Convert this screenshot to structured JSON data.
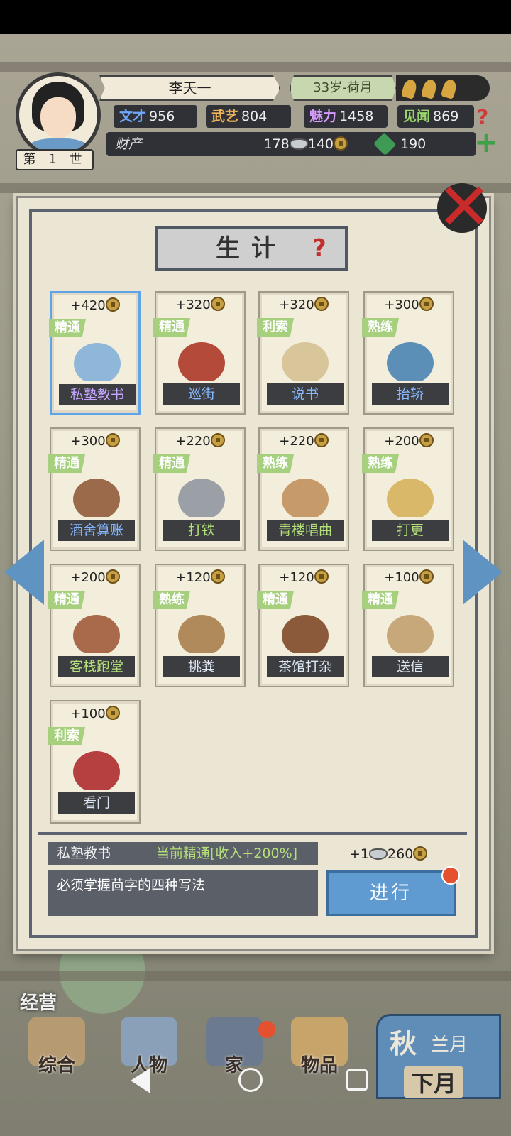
{
  "hud": {
    "name": "李天一",
    "age": "33岁-荷月",
    "generation": "第 1 世",
    "stats": [
      {
        "key": "文才",
        "value": "956"
      },
      {
        "key": "武艺",
        "value": "804"
      },
      {
        "key": "魅力",
        "value": "1458"
      },
      {
        "key": "见闻",
        "value": "869"
      }
    ],
    "wealth_label": "财产",
    "silver": "178",
    "coins": "140",
    "jade": "190",
    "help_icon": "question-icon",
    "plus_icon": "plus-icon"
  },
  "modal": {
    "title": "生计",
    "jobs": [
      {
        "income": "+420",
        "rank": "精通",
        "name": "私塾教书",
        "name_color": "purple",
        "selected": true
      },
      {
        "income": "+320",
        "rank": "精通",
        "name": "巡街",
        "name_color": "blue"
      },
      {
        "income": "+320",
        "rank": "利索",
        "name": "说书",
        "name_color": "blue"
      },
      {
        "income": "+300",
        "rank": "熟练",
        "name": "抬轿",
        "name_color": "blue"
      },
      {
        "income": "+300",
        "rank": "精通",
        "name": "酒舍算账",
        "name_color": "blue"
      },
      {
        "income": "+220",
        "rank": "精通",
        "name": "打铁",
        "name_color": "green"
      },
      {
        "income": "+220",
        "rank": "熟练",
        "name": "青楼唱曲",
        "name_color": "green"
      },
      {
        "income": "+200",
        "rank": "熟练",
        "name": "打更",
        "name_color": "green"
      },
      {
        "income": "+200",
        "rank": "精通",
        "name": "客栈跑堂",
        "name_color": "green"
      },
      {
        "income": "+120",
        "rank": "熟练",
        "name": "挑粪",
        "name_color": "plain"
      },
      {
        "income": "+120",
        "rank": "精通",
        "name": "茶馆打杂",
        "name_color": "plain"
      },
      {
        "income": "+100",
        "rank": "精通",
        "name": "送信",
        "name_color": "plain"
      },
      {
        "income": "+100",
        "rank": "利索",
        "name": "看门",
        "name_color": "plain"
      }
    ],
    "detail": {
      "job_name": "私塾教书",
      "status": "当前精通[收入+200%]",
      "reward_silver": "+1",
      "reward_coins": "260",
      "description": "必须掌握茴字的四种写法",
      "go_label": "进行"
    }
  },
  "bottom": {
    "manage_label": "经营",
    "tabs": [
      "综合",
      "人物",
      "家",
      "物品"
    ],
    "season_main": "秋",
    "season_month": "兰月",
    "next_month": "下月"
  },
  "colors": {
    "rank_bg": "#a6cf7e",
    "name_bg": "#3b3d40",
    "accent_blue": "#5f9ad1",
    "close_red": "#c92a2a"
  }
}
